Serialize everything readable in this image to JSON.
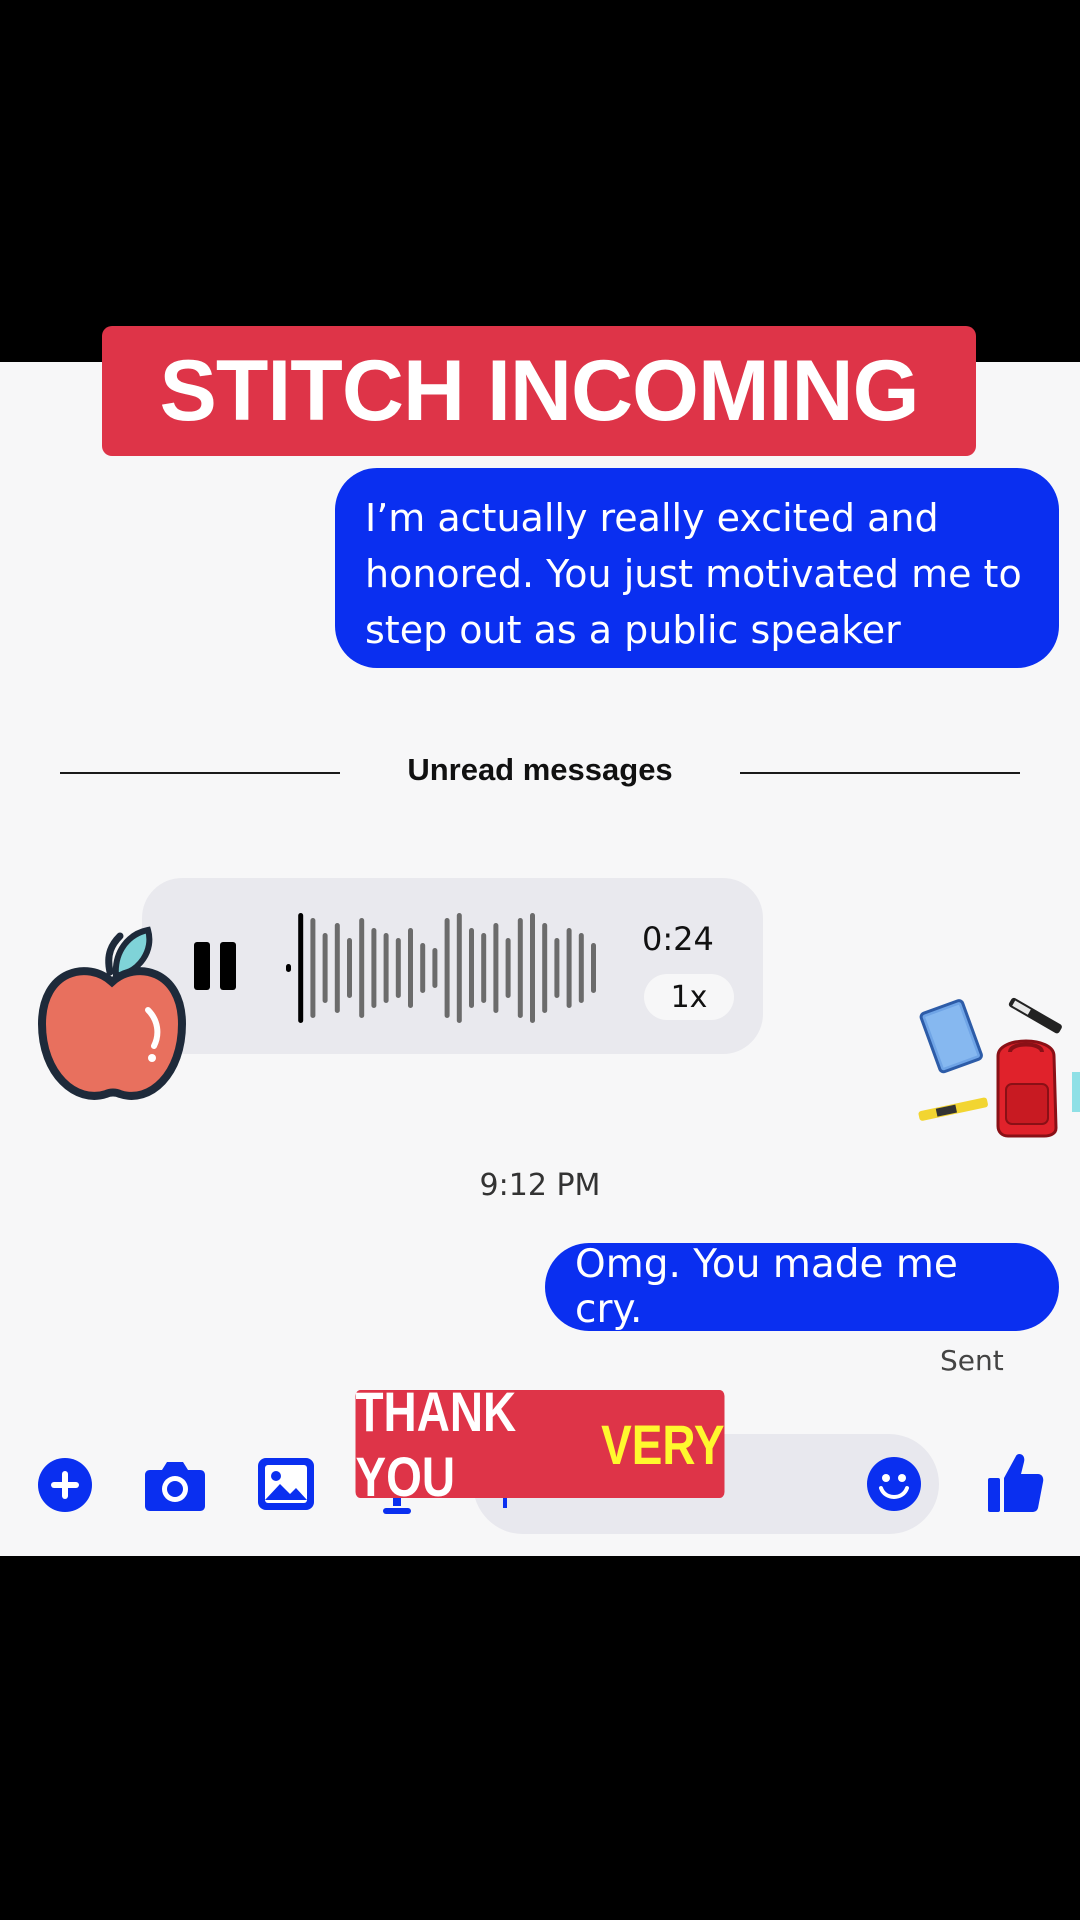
{
  "overlay": {
    "top_caption": "STITCH INCOMING",
    "bottom_caption_white": "THANK YOU",
    "bottom_caption_yellow": "VERY"
  },
  "messages": {
    "outgoing_1": "I’m actually really excited and honored. You just motivated me to step out as a public speaker",
    "unread_divider": "Unread messages",
    "voice_message": {
      "state": "playing",
      "duration": "0:24",
      "speed": "1x"
    },
    "timestamp": "9:12 PM",
    "outgoing_2": "Omg. You made me cry.",
    "status": "Sent"
  },
  "composer": {
    "buttons": [
      "plus-icon",
      "camera-icon",
      "gallery-icon",
      "microphone-icon"
    ],
    "emoji": "smile-icon",
    "like": "thumbs-up-icon"
  },
  "colors": {
    "accent_blue": "#0a2ff0",
    "caption_red": "#de3448",
    "caption_yellow": "#fff82e"
  }
}
